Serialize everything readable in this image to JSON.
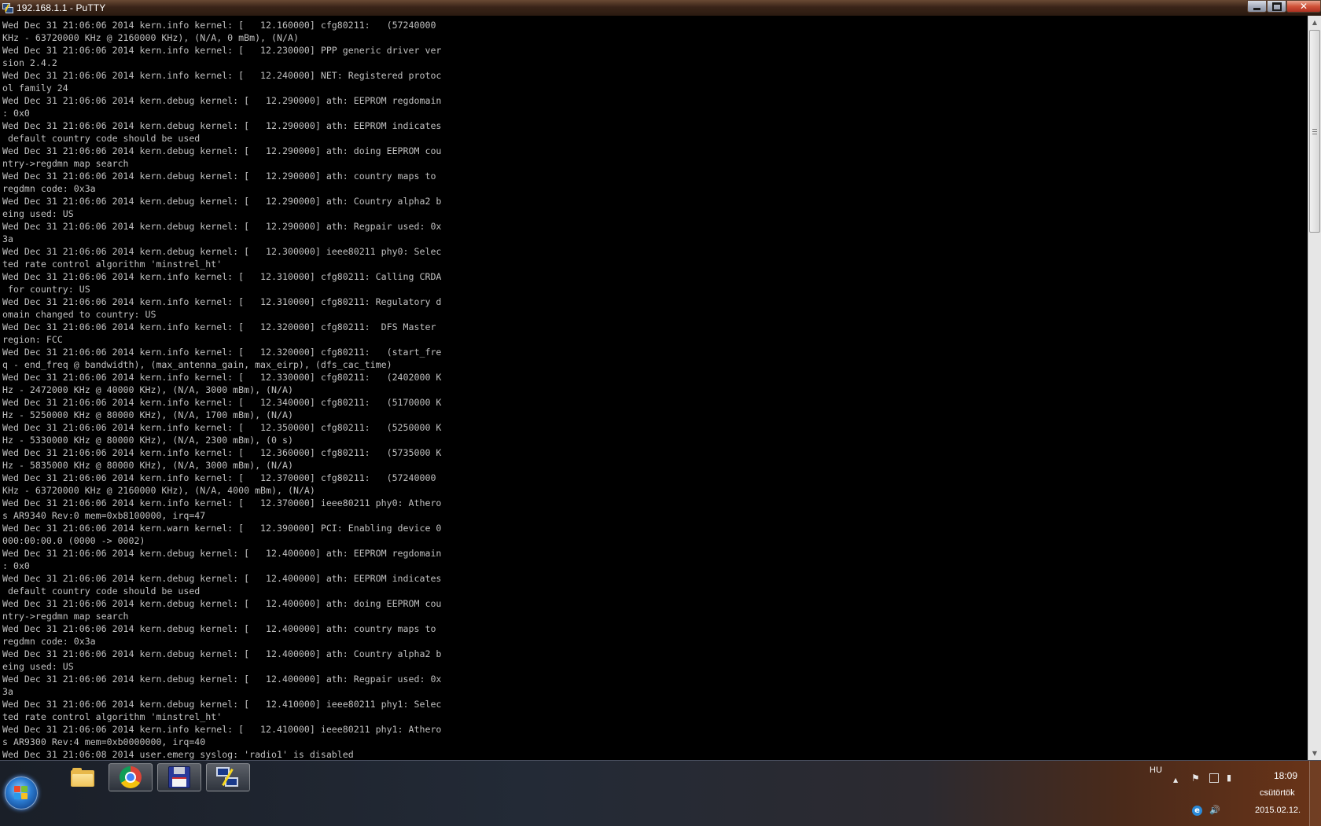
{
  "window": {
    "title": "192.168.1.1 - PuTTY",
    "min_label": "",
    "max_label": "",
    "close_label": "✕"
  },
  "terminal": {
    "lines": [
      "Wed Dec 31 21:06:06 2014 kern.info kernel: [   12.160000] cfg80211:   (57240000",
      "KHz - 63720000 KHz @ 2160000 KHz), (N/A, 0 mBm), (N/A)",
      "Wed Dec 31 21:06:06 2014 kern.info kernel: [   12.230000] PPP generic driver ver",
      "sion 2.4.2",
      "Wed Dec 31 21:06:06 2014 kern.info kernel: [   12.240000] NET: Registered protoc",
      "ol family 24",
      "Wed Dec 31 21:06:06 2014 kern.debug kernel: [   12.290000] ath: EEPROM regdomain",
      ": 0x0",
      "Wed Dec 31 21:06:06 2014 kern.debug kernel: [   12.290000] ath: EEPROM indicates",
      " default country code should be used",
      "Wed Dec 31 21:06:06 2014 kern.debug kernel: [   12.290000] ath: doing EEPROM cou",
      "ntry->regdmn map search",
      "Wed Dec 31 21:06:06 2014 kern.debug kernel: [   12.290000] ath: country maps to",
      "regdmn code: 0x3a",
      "Wed Dec 31 21:06:06 2014 kern.debug kernel: [   12.290000] ath: Country alpha2 b",
      "eing used: US",
      "Wed Dec 31 21:06:06 2014 kern.debug kernel: [   12.290000] ath: Regpair used: 0x",
      "3a",
      "Wed Dec 31 21:06:06 2014 kern.debug kernel: [   12.300000] ieee80211 phy0: Selec",
      "ted rate control algorithm 'minstrel_ht'",
      "Wed Dec 31 21:06:06 2014 kern.info kernel: [   12.310000] cfg80211: Calling CRDA",
      " for country: US",
      "Wed Dec 31 21:06:06 2014 kern.info kernel: [   12.310000] cfg80211: Regulatory d",
      "omain changed to country: US",
      "Wed Dec 31 21:06:06 2014 kern.info kernel: [   12.320000] cfg80211:  DFS Master",
      "region: FCC",
      "Wed Dec 31 21:06:06 2014 kern.info kernel: [   12.320000] cfg80211:   (start_fre",
      "q - end_freq @ bandwidth), (max_antenna_gain, max_eirp), (dfs_cac_time)",
      "Wed Dec 31 21:06:06 2014 kern.info kernel: [   12.330000] cfg80211:   (2402000 K",
      "Hz - 2472000 KHz @ 40000 KHz), (N/A, 3000 mBm), (N/A)",
      "Wed Dec 31 21:06:06 2014 kern.info kernel: [   12.340000] cfg80211:   (5170000 K",
      "Hz - 5250000 KHz @ 80000 KHz), (N/A, 1700 mBm), (N/A)",
      "Wed Dec 31 21:06:06 2014 kern.info kernel: [   12.350000] cfg80211:   (5250000 K",
      "Hz - 5330000 KHz @ 80000 KHz), (N/A, 2300 mBm), (0 s)",
      "Wed Dec 31 21:06:06 2014 kern.info kernel: [   12.360000] cfg80211:   (5735000 K",
      "Hz - 5835000 KHz @ 80000 KHz), (N/A, 3000 mBm), (N/A)",
      "Wed Dec 31 21:06:06 2014 kern.info kernel: [   12.370000] cfg80211:   (57240000",
      "KHz - 63720000 KHz @ 2160000 KHz), (N/A, 4000 mBm), (N/A)",
      "Wed Dec 31 21:06:06 2014 kern.info kernel: [   12.370000] ieee80211 phy0: Athero",
      "s AR9340 Rev:0 mem=0xb8100000, irq=47",
      "Wed Dec 31 21:06:06 2014 kern.warn kernel: [   12.390000] PCI: Enabling device 0",
      "000:00:00.0 (0000 -> 0002)",
      "Wed Dec 31 21:06:06 2014 kern.debug kernel: [   12.400000] ath: EEPROM regdomain",
      ": 0x0",
      "Wed Dec 31 21:06:06 2014 kern.debug kernel: [   12.400000] ath: EEPROM indicates",
      " default country code should be used",
      "Wed Dec 31 21:06:06 2014 kern.debug kernel: [   12.400000] ath: doing EEPROM cou",
      "ntry->regdmn map search",
      "Wed Dec 31 21:06:06 2014 kern.debug kernel: [   12.400000] ath: country maps to",
      "regdmn code: 0x3a",
      "Wed Dec 31 21:06:06 2014 kern.debug kernel: [   12.400000] ath: Country alpha2 b",
      "eing used: US",
      "Wed Dec 31 21:06:06 2014 kern.debug kernel: [   12.400000] ath: Regpair used: 0x",
      "3a",
      "Wed Dec 31 21:06:06 2014 kern.debug kernel: [   12.410000] ieee80211 phy1: Selec",
      "ted rate control algorithm 'minstrel_ht'",
      "Wed Dec 31 21:06:06 2014 kern.info kernel: [   12.410000] ieee80211 phy1: Athero",
      "s AR9300 Rev:4 mem=0xb0000000, irq=40",
      "Wed Dec 31 21:06:08 2014 user.emerg syslog: 'radio1' is disabled"
    ]
  },
  "scrollbar": {
    "up_arrow": "▲",
    "down_arrow": "▼",
    "position_fraction": 0.0
  },
  "taskbar": {
    "apps": [
      {
        "name": "file-explorer",
        "icon": "folder-icon"
      },
      {
        "name": "chrome",
        "icon": "chrome-icon"
      },
      {
        "name": "save-app",
        "icon": "floppy-icon"
      },
      {
        "name": "putty",
        "icon": "putty-icon",
        "active": true
      }
    ],
    "tray": {
      "language": "HU",
      "show_hidden": "▲",
      "flag": "⚑",
      "volume": "🔊",
      "ie": "e",
      "signal": "▮"
    },
    "clock": {
      "time": "18:09",
      "day": "csütörtök",
      "date": "2015.02.12."
    }
  },
  "colors": {
    "terminal_bg": "#000000",
    "terminal_fg": "#c0c0c0",
    "titlebar": "#3a2418",
    "taskbar": "#232a36"
  }
}
